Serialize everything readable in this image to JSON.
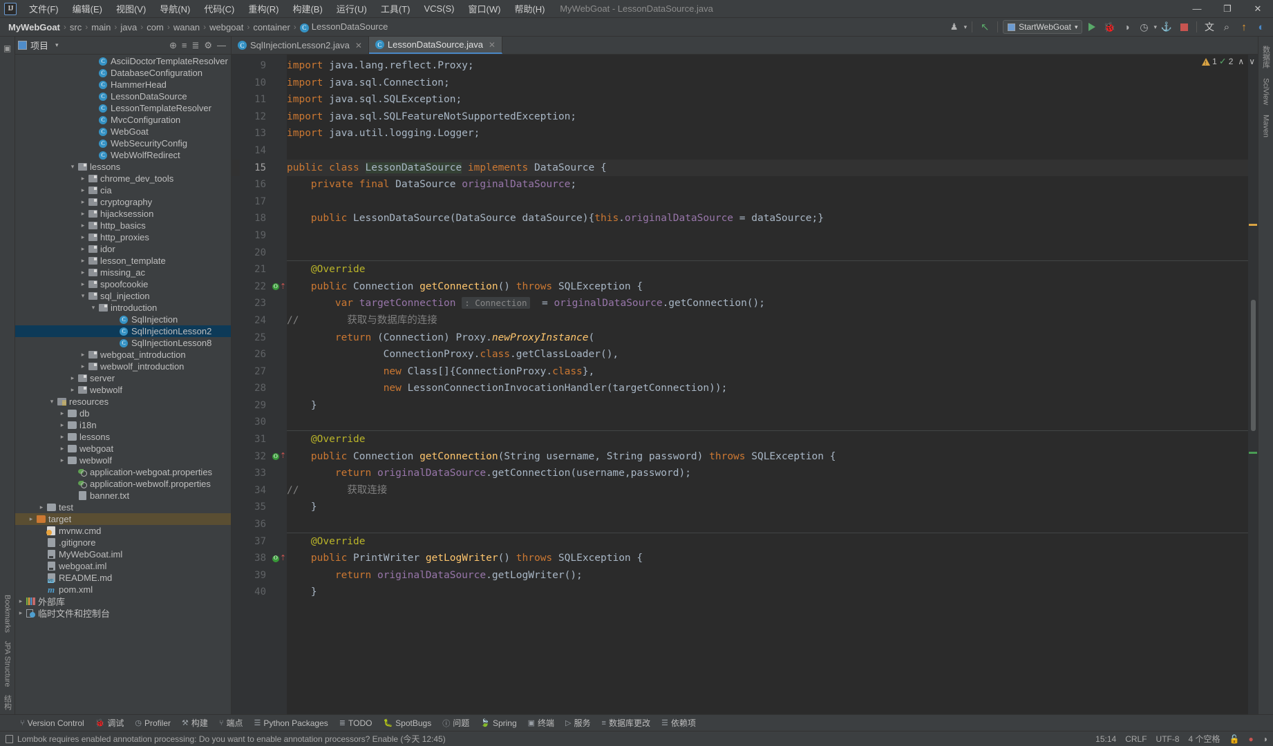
{
  "window": {
    "title": "MyWebGoat - LessonDataSource.java",
    "logo_text": "IJ",
    "minimize": "—",
    "maximize": "❐",
    "close": "✕"
  },
  "menubar": [
    {
      "label": "文件(F)"
    },
    {
      "label": "编辑(E)"
    },
    {
      "label": "视图(V)"
    },
    {
      "label": "导航(N)"
    },
    {
      "label": "代码(C)"
    },
    {
      "label": "重构(R)"
    },
    {
      "label": "构建(B)"
    },
    {
      "label": "运行(U)"
    },
    {
      "label": "工具(T)"
    },
    {
      "label": "VCS(S)"
    },
    {
      "label": "窗口(W)"
    },
    {
      "label": "帮助(H)"
    }
  ],
  "breadcrumb": {
    "items": [
      "MyWebGoat",
      "src",
      "main",
      "java",
      "com",
      "wanan",
      "webgoat",
      "container"
    ],
    "last": "LessonDataSource",
    "last_icon": "class-icon",
    "separator": "›"
  },
  "toolbar": {
    "run_config": "StartWebGoat",
    "dropdown_arrow": "▾",
    "icons": [
      {
        "name": "profile-icon",
        "glyph": "♟"
      },
      {
        "name": "back-arrow-icon",
        "glyph": "↖"
      },
      {
        "name": "run-icon",
        "glyph": "▶"
      },
      {
        "name": "debug-icon",
        "glyph": "🐞"
      },
      {
        "name": "run-coverage-icon",
        "glyph": "◑"
      },
      {
        "name": "profiler-icon",
        "glyph": "◷"
      },
      {
        "name": "attach-icon",
        "glyph": "⚓"
      },
      {
        "name": "stop-icon",
        "glyph": "■"
      },
      {
        "name": "translate-icon",
        "glyph": "文"
      },
      {
        "name": "search-icon",
        "glyph": "⌕"
      },
      {
        "name": "update-icon",
        "glyph": "↑"
      },
      {
        "name": "settings-icon",
        "glyph": "◐"
      }
    ]
  },
  "left_rail": {
    "top_icon": "project-icon",
    "items": [
      "Bookmarks",
      "JPA Structure",
      "结构"
    ]
  },
  "right_rail": {
    "items": [
      "数据库",
      "SciView",
      "Maven"
    ]
  },
  "project_panel": {
    "title": "项目",
    "dropdown_arrow": "▾",
    "header_icons": [
      {
        "name": "locate-icon",
        "glyph": "⊕"
      },
      {
        "name": "expand-all-icon",
        "glyph": "≡"
      },
      {
        "name": "collapse-all-icon",
        "glyph": "≣"
      },
      {
        "name": "settings-icon",
        "glyph": "⚙"
      },
      {
        "name": "hide-icon",
        "glyph": "—"
      }
    ],
    "tree": [
      {
        "label": "AsciiDoctorTemplateResolver",
        "indent": 7,
        "icon": "class",
        "arrow": "none",
        "clipped": true
      },
      {
        "label": "DatabaseConfiguration",
        "indent": 7,
        "icon": "class",
        "arrow": "none"
      },
      {
        "label": "HammerHead",
        "indent": 7,
        "icon": "class",
        "arrow": "none"
      },
      {
        "label": "LessonDataSource",
        "indent": 7,
        "icon": "class",
        "arrow": "none"
      },
      {
        "label": "LessonTemplateResolver",
        "indent": 7,
        "icon": "class",
        "arrow": "none"
      },
      {
        "label": "MvcConfiguration",
        "indent": 7,
        "icon": "class",
        "arrow": "none"
      },
      {
        "label": "WebGoat",
        "indent": 7,
        "icon": "class",
        "arrow": "none"
      },
      {
        "label": "WebSecurityConfig",
        "indent": 7,
        "icon": "class",
        "arrow": "none"
      },
      {
        "label": "WebWolfRedirect",
        "indent": 7,
        "icon": "class",
        "arrow": "none"
      },
      {
        "label": "lessons",
        "indent": 5,
        "icon": "pkg",
        "arrow": "open"
      },
      {
        "label": "chrome_dev_tools",
        "indent": 6,
        "icon": "pkg",
        "arrow": "closed"
      },
      {
        "label": "cia",
        "indent": 6,
        "icon": "pkg",
        "arrow": "closed"
      },
      {
        "label": "cryptography",
        "indent": 6,
        "icon": "pkg",
        "arrow": "closed"
      },
      {
        "label": "hijacksession",
        "indent": 6,
        "icon": "pkg",
        "arrow": "closed"
      },
      {
        "label": "http_basics",
        "indent": 6,
        "icon": "pkg",
        "arrow": "closed"
      },
      {
        "label": "http_proxies",
        "indent": 6,
        "icon": "pkg",
        "arrow": "closed"
      },
      {
        "label": "idor",
        "indent": 6,
        "icon": "pkg",
        "arrow": "closed"
      },
      {
        "label": "lesson_template",
        "indent": 6,
        "icon": "pkg",
        "arrow": "closed"
      },
      {
        "label": "missing_ac",
        "indent": 6,
        "icon": "pkg",
        "arrow": "closed"
      },
      {
        "label": "spoofcookie",
        "indent": 6,
        "icon": "pkg",
        "arrow": "closed"
      },
      {
        "label": "sql_injection",
        "indent": 6,
        "icon": "pkg",
        "arrow": "open"
      },
      {
        "label": "introduction",
        "indent": 7,
        "icon": "pkg",
        "arrow": "open"
      },
      {
        "label": "SqlInjection",
        "indent": 9,
        "icon": "class",
        "arrow": "none"
      },
      {
        "label": "SqlInjectionLesson2",
        "indent": 9,
        "icon": "class",
        "arrow": "none",
        "selected": true
      },
      {
        "label": "SqlInjectionLesson8",
        "indent": 9,
        "icon": "class",
        "arrow": "none"
      },
      {
        "label": "webgoat_introduction",
        "indent": 6,
        "icon": "pkg",
        "arrow": "closed"
      },
      {
        "label": "webwolf_introduction",
        "indent": 6,
        "icon": "pkg",
        "arrow": "closed"
      },
      {
        "label": "server",
        "indent": 5,
        "icon": "pkg",
        "arrow": "closed"
      },
      {
        "label": "webwolf",
        "indent": 5,
        "icon": "pkg",
        "arrow": "closed"
      },
      {
        "label": "resources",
        "indent": 3,
        "icon": "res",
        "arrow": "open"
      },
      {
        "label": "db",
        "indent": 4,
        "icon": "folder",
        "arrow": "closed"
      },
      {
        "label": "i18n",
        "indent": 4,
        "icon": "folder",
        "arrow": "closed"
      },
      {
        "label": "lessons",
        "indent": 4,
        "icon": "folder",
        "arrow": "closed"
      },
      {
        "label": "webgoat",
        "indent": 4,
        "icon": "folder",
        "arrow": "closed"
      },
      {
        "label": "webwolf",
        "indent": 4,
        "icon": "folder",
        "arrow": "closed"
      },
      {
        "label": "application-webgoat.properties",
        "indent": 5,
        "icon": "props",
        "arrow": "none"
      },
      {
        "label": "application-webwolf.properties",
        "indent": 5,
        "icon": "props",
        "arrow": "none"
      },
      {
        "label": "banner.txt",
        "indent": 5,
        "icon": "file",
        "arrow": "none"
      },
      {
        "label": "test",
        "indent": 2,
        "icon": "folder",
        "arrow": "closed"
      },
      {
        "label": "target",
        "indent": 1,
        "icon": "target",
        "arrow": "closed",
        "highlight": true
      },
      {
        "label": "mvnw.cmd",
        "indent": 2,
        "icon": "cmd",
        "arrow": "none"
      },
      {
        "label": ".gitignore",
        "indent": 2,
        "icon": "file",
        "arrow": "none"
      },
      {
        "label": "MyWebGoat.iml",
        "indent": 2,
        "icon": "iml",
        "arrow": "none"
      },
      {
        "label": "webgoat.iml",
        "indent": 2,
        "icon": "iml",
        "arrow": "none"
      },
      {
        "label": "README.md",
        "indent": 2,
        "icon": "md",
        "arrow": "none"
      },
      {
        "label": "pom.xml",
        "indent": 2,
        "icon": "maven",
        "arrow": "none"
      },
      {
        "label": "外部库",
        "indent": 0,
        "icon": "lib",
        "arrow": "closed"
      },
      {
        "label": "临时文件和控制台",
        "indent": 0,
        "icon": "scratch",
        "arrow": "closed"
      }
    ]
  },
  "editor": {
    "tabs": [
      {
        "label": "SqlInjectionLesson2.java",
        "active": false,
        "closable": true
      },
      {
        "label": "LessonDataSource.java",
        "active": true,
        "closable": true
      }
    ],
    "close_glyph": "✕",
    "inspection": {
      "warning_count": "1",
      "ok_count": "2",
      "up_glyph": "∧",
      "down_glyph": "∨"
    },
    "first_line_number": 9,
    "lines": [
      {
        "n": 9,
        "html": "<span class='kw'>import</span> java.lang.reflect.Proxy;"
      },
      {
        "n": 10,
        "html": "<span class='kw'>import</span> java.sql.Connection;"
      },
      {
        "n": 11,
        "html": "<span class='kw'>import</span> java.sql.SQLException;"
      },
      {
        "n": 12,
        "html": "<span class='kw'>import</span> java.sql.SQLFeatureNotSupportedException;"
      },
      {
        "n": 13,
        "html": "<span class='kw'>import</span> java.util.logging.Logger;"
      },
      {
        "n": 14,
        "html": ""
      },
      {
        "n": 15,
        "html": "<span class='kw'>public class</span> <span class='hl-class'>LessonDataSource</span> <span class='kw'>implements</span> DataSource {",
        "current": true
      },
      {
        "n": 16,
        "html": "    <span class='kw'>private final</span> DataSource <span class='fld'>originalDataSource</span>;"
      },
      {
        "n": 17,
        "html": ""
      },
      {
        "n": 18,
        "html": "    <span class='kw'>public</span> <span class='cls'>LessonDataSource</span>(DataSource dataSource){<span class='kw'>this</span>.<span class='fld'>originalDataSource</span> = dataSource;}"
      },
      {
        "n": 19,
        "html": ""
      },
      {
        "n": 20,
        "html": "",
        "sep_after": true
      },
      {
        "n": 21,
        "html": "    <span class='ann'>@Override</span>"
      },
      {
        "n": 22,
        "html": "    <span class='kw'>public</span> Connection <span class='mth'>getConnection</span>() <span class='kw'>throws</span> SQLException {",
        "marker": "override"
      },
      {
        "n": 23,
        "html": "        <span class='kw'>var</span> <span class='fld'>targetConnection</span> <span class='hint'>: Connection</span>  = <span class='fld'>originalDataSource</span>.getConnection();"
      },
      {
        "n": 24,
        "html": "",
        "comment_prefix": "//",
        "comment_text": "获取与数据库的连接"
      },
      {
        "n": 25,
        "html": "        <span class='kw'>return</span> (Connection) Proxy.<span class='mth ital'>newProxyInstance</span>("
      },
      {
        "n": 26,
        "html": "                ConnectionProxy.<span class='kw'>class</span>.getClassLoader(),"
      },
      {
        "n": 27,
        "html": "                <span class='kw'>new</span> Class[]{ConnectionProxy.<span class='kw'>class</span>},"
      },
      {
        "n": 28,
        "html": "                <span class='kw'>new</span> LessonConnectionInvocationHandler(targetConnection));"
      },
      {
        "n": 29,
        "html": "    }"
      },
      {
        "n": 30,
        "html": "",
        "sep_after": true
      },
      {
        "n": 31,
        "html": "    <span class='ann'>@Override</span>"
      },
      {
        "n": 32,
        "html": "    <span class='kw'>public</span> Connection <span class='mth'>getConnection</span>(String username, String password) <span class='kw'>throws</span> SQLException {",
        "marker": "override"
      },
      {
        "n": 33,
        "html": "        <span class='kw'>return</span> <span class='fld'>originalDataSource</span>.getConnection(username,password);"
      },
      {
        "n": 34,
        "html": "",
        "comment_prefix": "//",
        "comment_text": "获取连接"
      },
      {
        "n": 35,
        "html": "    }"
      },
      {
        "n": 36,
        "html": "",
        "sep_after": true
      },
      {
        "n": 37,
        "html": "    <span class='ann'>@Override</span>"
      },
      {
        "n": 38,
        "html": "    <span class='kw'>public</span> PrintWriter <span class='mth'>getLogWriter</span>() <span class='kw'>throws</span> SQLException {",
        "marker": "override"
      },
      {
        "n": 39,
        "html": "        <span class='kw'>return</span> <span class='fld'>originalDataSource</span>.getLogWriter();"
      },
      {
        "n": 40,
        "html": "    }"
      }
    ]
  },
  "bottom_tools": [
    {
      "label": "Version Control",
      "icon": "⑂"
    },
    {
      "label": "调试",
      "icon": "🐞"
    },
    {
      "label": "Profiler",
      "icon": "◷"
    },
    {
      "label": "构建",
      "icon": "⚒"
    },
    {
      "label": "端点",
      "icon": "⑂"
    },
    {
      "label": "Python Packages",
      "icon": "☰"
    },
    {
      "label": "TODO",
      "icon": "≣"
    },
    {
      "label": "SpotBugs",
      "icon": "🐛"
    },
    {
      "label": "问题",
      "icon": "ⓘ"
    },
    {
      "label": "Spring",
      "icon": "🍃"
    },
    {
      "label": "终端",
      "icon": "▣"
    },
    {
      "label": "服务",
      "icon": "▷"
    },
    {
      "label": "数据库更改",
      "icon": "≡"
    },
    {
      "label": "依赖项",
      "icon": "☰"
    }
  ],
  "status_bar": {
    "message": "Lombok requires enabled annotation processing: Do you want to enable annotation processors? Enable (今天 12:45)",
    "caret_position": "15:14",
    "line_separator": "CRLF",
    "encoding": "UTF-8",
    "indent": "4 个空格",
    "lock_icon": "🔓",
    "error_icon": "●",
    "memory_icon": "◑"
  }
}
